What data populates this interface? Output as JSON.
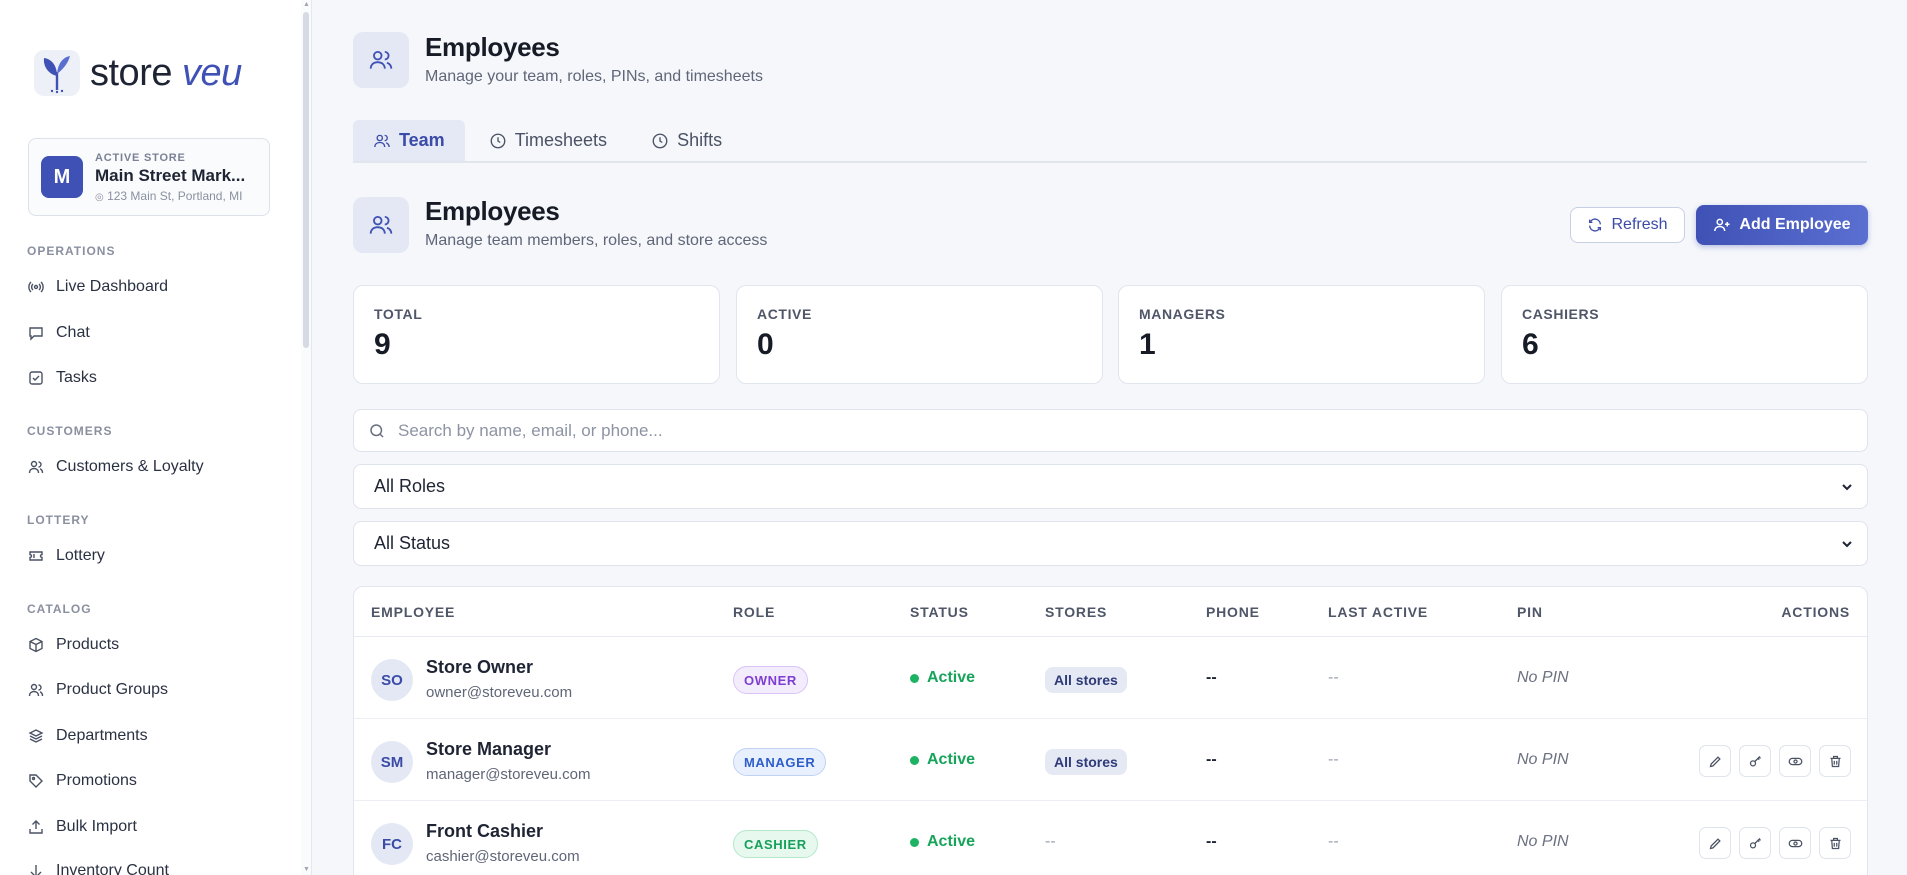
{
  "brand": {
    "name_main": "store",
    "name_accent": "veu"
  },
  "store": {
    "kicker": "ACTIVE STORE",
    "initial": "M",
    "name": "Main Street Mark...",
    "address": "123 Main St, Portland, MI"
  },
  "nav": {
    "sections": [
      {
        "label": "OPERATIONS",
        "items": [
          {
            "label": "Live Dashboard",
            "icon": "broadcast-icon"
          },
          {
            "label": "Chat",
            "icon": "chat-icon"
          },
          {
            "label": "Tasks",
            "icon": "checkbox-icon"
          }
        ]
      },
      {
        "label": "CUSTOMERS",
        "items": [
          {
            "label": "Customers & Loyalty",
            "icon": "users-icon"
          }
        ]
      },
      {
        "label": "LOTTERY",
        "items": [
          {
            "label": "Lottery",
            "icon": "ticket-icon"
          }
        ]
      },
      {
        "label": "CATALOG",
        "items": [
          {
            "label": "Products",
            "icon": "box-icon"
          },
          {
            "label": "Product Groups",
            "icon": "users-icon"
          },
          {
            "label": "Departments",
            "icon": "layers-icon"
          },
          {
            "label": "Promotions",
            "icon": "tag-icon"
          },
          {
            "label": "Bulk Import",
            "icon": "upload-icon"
          },
          {
            "label": "Inventory Count",
            "icon": "clipboard-icon"
          }
        ]
      }
    ]
  },
  "page": {
    "title": "Employees",
    "subtitle": "Manage your team, roles, PINs, and timesheets"
  },
  "tabs": [
    {
      "label": "Team",
      "active": true
    },
    {
      "label": "Timesheets",
      "active": false
    },
    {
      "label": "Shifts",
      "active": false
    }
  ],
  "section": {
    "title": "Employees",
    "subtitle": "Manage team members, roles, and store access"
  },
  "buttons": {
    "refresh": "Refresh",
    "add": "Add Employee"
  },
  "stats": [
    {
      "label": "TOTAL",
      "value": "9"
    },
    {
      "label": "ACTIVE",
      "value": "0"
    },
    {
      "label": "MANAGERS",
      "value": "1"
    },
    {
      "label": "CASHIERS",
      "value": "6"
    }
  ],
  "search": {
    "placeholder": "Search by name, email, or phone..."
  },
  "filters": {
    "role": "All Roles",
    "status": "All Status"
  },
  "table": {
    "headers": [
      "EMPLOYEE",
      "ROLE",
      "STATUS",
      "STORES",
      "PHONE",
      "LAST ACTIVE",
      "PIN",
      "ACTIONS"
    ],
    "rows": [
      {
        "initials": "SO",
        "name": "Store Owner",
        "email": "owner@storeveu.com",
        "role": "OWNER",
        "status": "Active",
        "stores": "All stores",
        "phone": "--",
        "last_active": "--",
        "pin": "No PIN"
      },
      {
        "initials": "SM",
        "name": "Store Manager",
        "email": "manager@storeveu.com",
        "role": "MANAGER",
        "status": "Active",
        "stores": "All stores",
        "phone": "--",
        "last_active": "--",
        "pin": "No PIN"
      },
      {
        "initials": "FC",
        "name": "Front Cashier",
        "email": "cashier@storeveu.com",
        "role": "CASHIER",
        "status": "Active",
        "stores": "--",
        "phone": "--",
        "last_active": "--",
        "pin": "No PIN"
      }
    ]
  },
  "colors": {
    "accent": "#3f51b5",
    "active": "#17a35a",
    "owner": "#7d3ed1",
    "manager": "#2e5ec9",
    "cashier": "#16a05a"
  }
}
